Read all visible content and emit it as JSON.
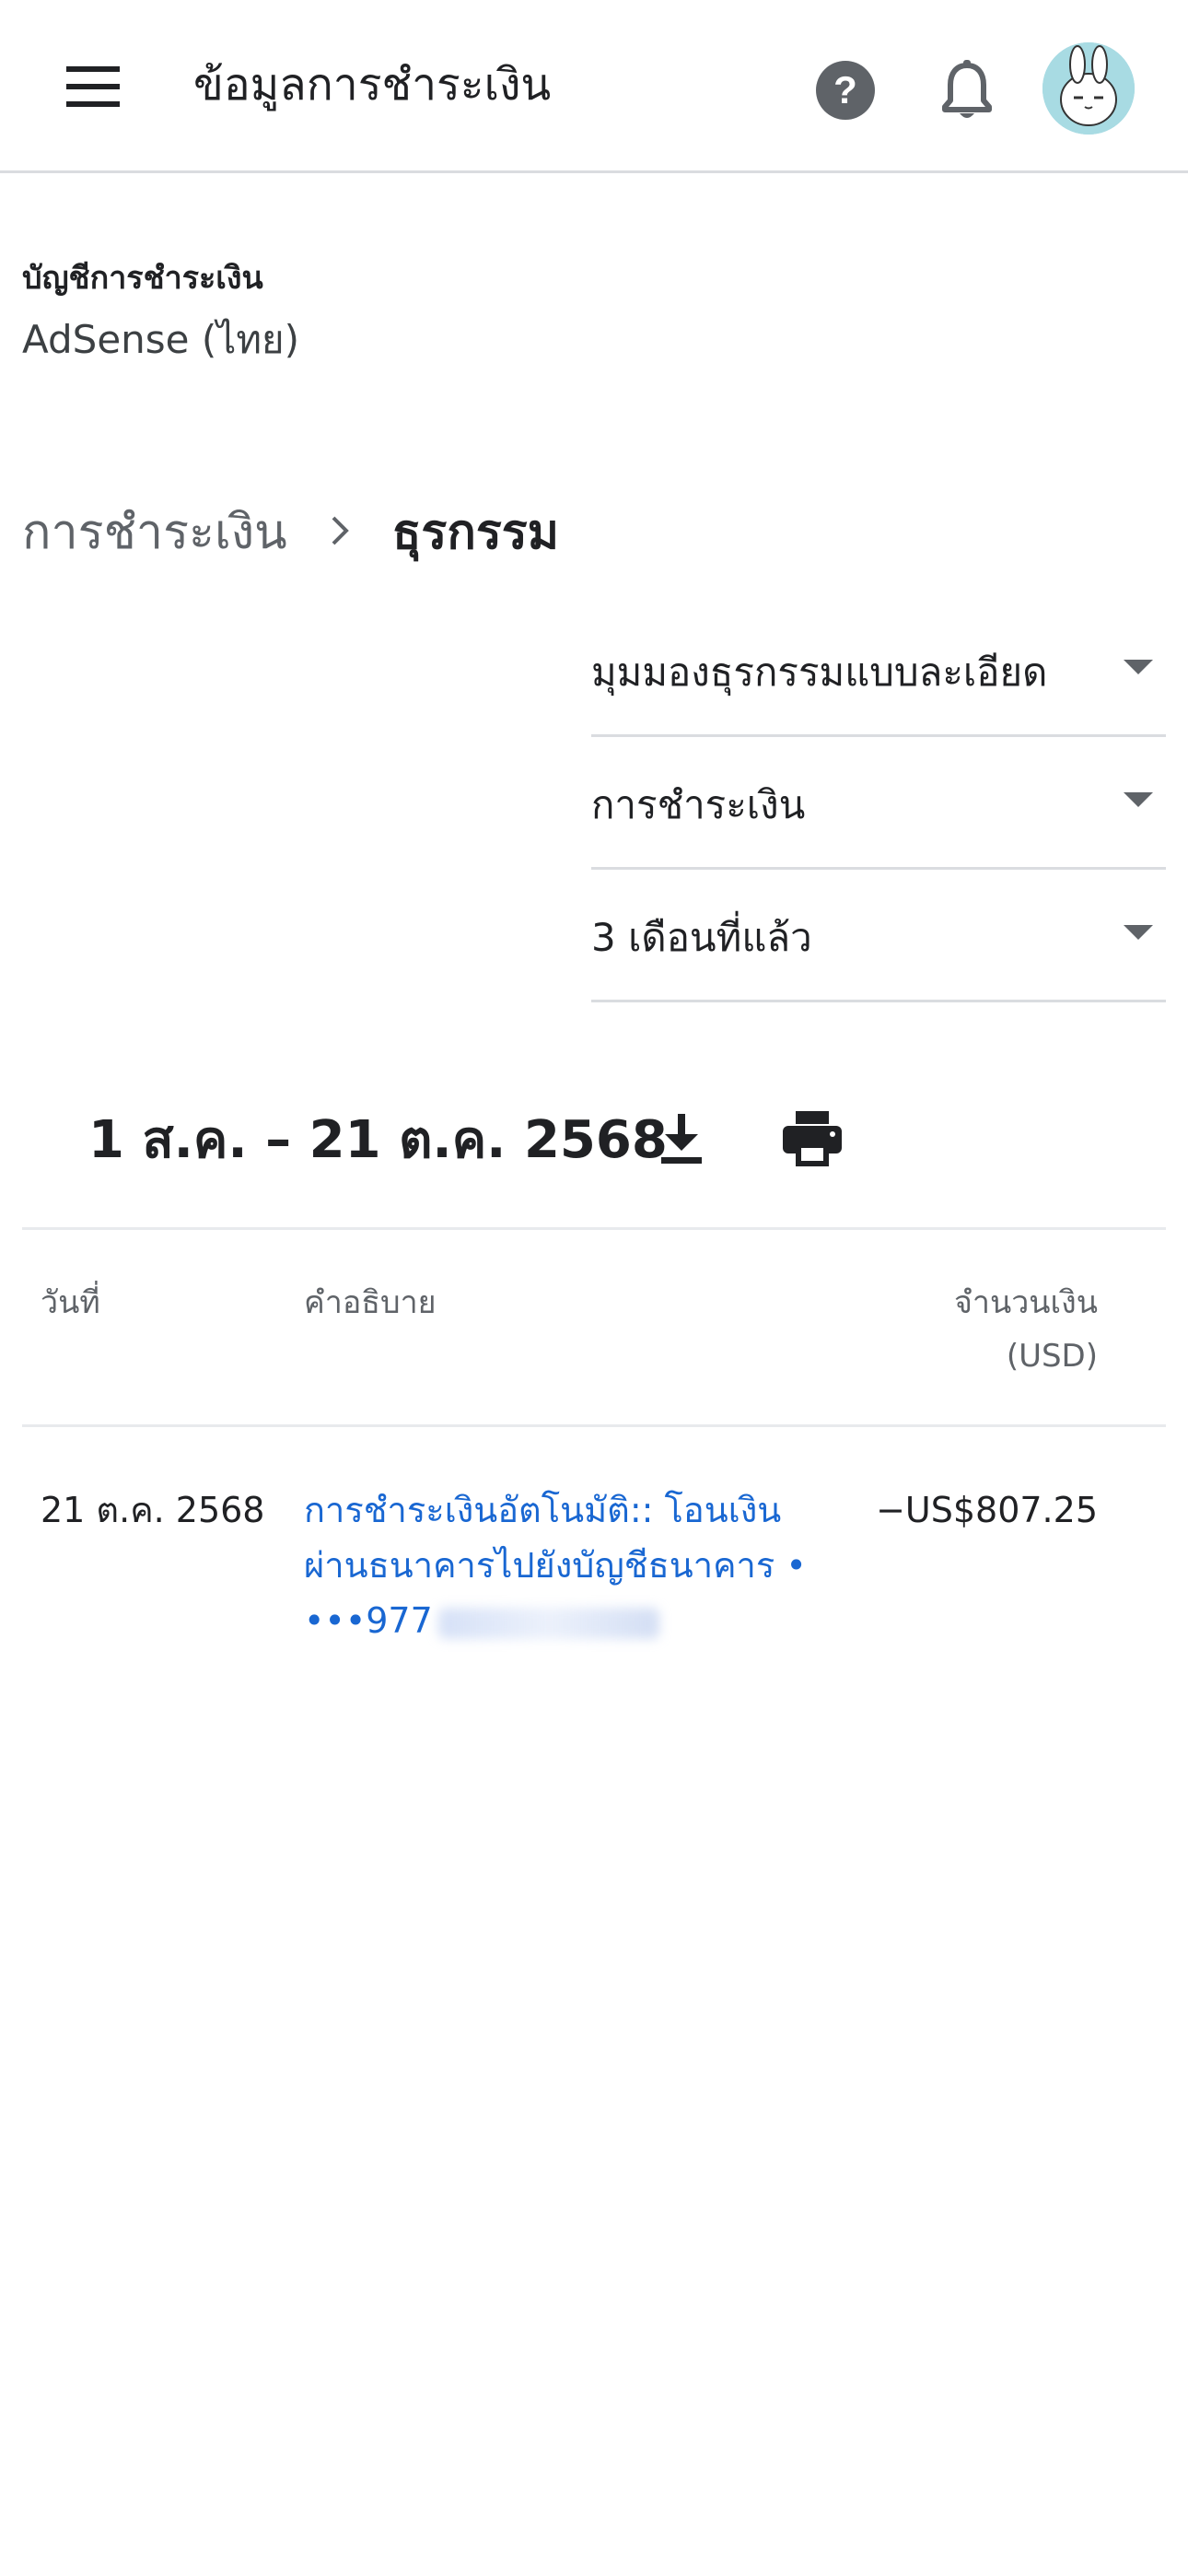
{
  "appbar": {
    "title": "ข้อมูลการชำระเงิน",
    "menu_icon": "menu-icon",
    "help_icon": "help-icon",
    "notification_icon": "bell-icon",
    "avatar_icon": "avatar"
  },
  "account": {
    "label": "บัญชีการชำระเงิน",
    "value": "AdSense (ไทย)"
  },
  "breadcrumb": {
    "parent": "การชำระเงิน",
    "current": "ธุรกรรม"
  },
  "filters": {
    "view": "มุมมองธุรกรรมแบบละเอียด",
    "type": "การชำระเงิน",
    "period": "3 เดือนที่แล้ว"
  },
  "range": {
    "text": "1 ส.ค. – 21 ต.ค. 2568"
  },
  "table": {
    "headers": {
      "date": "วันที่",
      "description": "คำอธิบาย",
      "amount_line1": "จำนวนเงิน",
      "amount_line2": "(USD)"
    },
    "rows": [
      {
        "date": "21 ต.ค. 2568",
        "desc_line1": "การชำระเงินอัตโนมัติ:: โอนเงิน",
        "desc_line2": "ผ่านธนาคารไปยังบัญชีธนาคาร •",
        "desc_line3": "•••977",
        "amount": "−US$807.25"
      }
    ]
  },
  "colors": {
    "link": "#1967d2",
    "text": "#202124",
    "muted": "#5f6368",
    "divider": "#dadce0"
  }
}
